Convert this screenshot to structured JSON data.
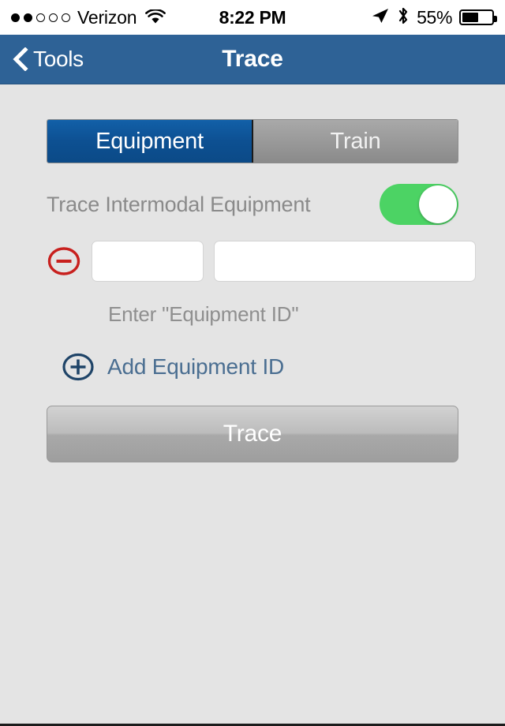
{
  "status_bar": {
    "signal_dots_filled": 2,
    "signal_dots_total": 5,
    "carrier": "Verizon",
    "wifi_icon": "wifi-icon",
    "time": "8:22 PM",
    "location_icon": "location-arrow-icon",
    "bluetooth_icon": "bluetooth-icon",
    "battery_percent": "55%",
    "battery_level": 55
  },
  "navbar": {
    "back_icon": "chevron-left-icon",
    "back_label": "Tools",
    "title": "Trace",
    "background_color": "#2e6296"
  },
  "segmented_control": {
    "selected_index": 0,
    "selected_color": "#0d5092",
    "segments": [
      {
        "label": "Equipment"
      },
      {
        "label": "Train"
      }
    ]
  },
  "toggle": {
    "label": "Trace Intermodal Equipment",
    "on": true,
    "on_color": "#4cd364"
  },
  "equipment_rows": [
    {
      "remove_icon": "circle-minus-icon",
      "remove_icon_color": "#c8201e",
      "prefix_value": "",
      "prefix_placeholder": "",
      "number_value": "",
      "number_placeholder": ""
    }
  ],
  "hint": "Enter \"Equipment ID\"",
  "add_row": {
    "icon": "circle-plus-icon",
    "icon_color": "#1f4468",
    "label": "Add Equipment ID",
    "label_color": "#4a6e91"
  },
  "primary_button": {
    "label": "Trace",
    "enabled": false
  },
  "background_color": "#e4e4e4"
}
